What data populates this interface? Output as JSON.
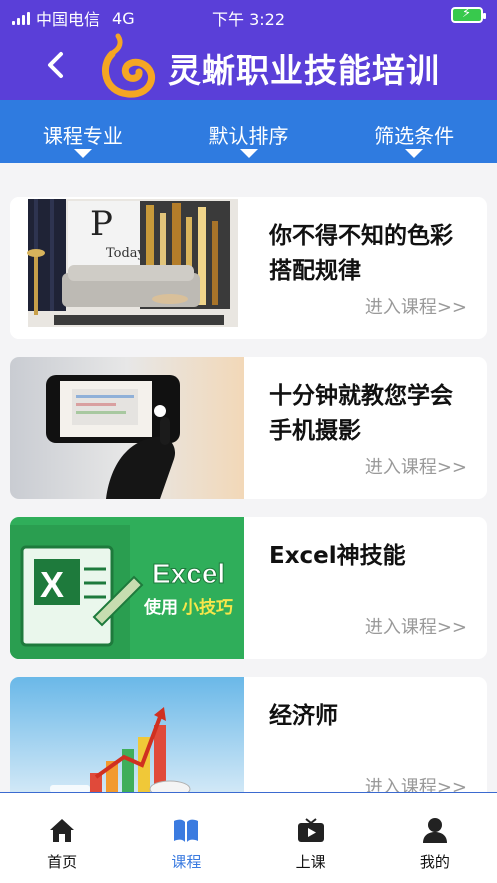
{
  "status_bar": {
    "carrier": "中国电信",
    "network": "4G",
    "time": "下午 3:22"
  },
  "header": {
    "title": "灵蜥职业技能培训",
    "back_icon": "chevron-left-icon",
    "logo_icon": "spiral-logo-icon"
  },
  "filters": [
    {
      "label": "课程专业"
    },
    {
      "label": "默认排序"
    },
    {
      "label": "筛选条件"
    }
  ],
  "courses": [
    {
      "title": "你不得不知的色彩搭配规律",
      "link": "进入课程>>",
      "thumb": "interior-design-thumbnail"
    },
    {
      "title": "十分钟就教您学会手机摄影",
      "link": "进入课程>>",
      "thumb": "phone-photography-thumbnail"
    },
    {
      "title": "Excel神技能",
      "link": "进入课程>>",
      "thumb": "excel-tips-thumbnail",
      "thumb_text": {
        "brand": "Excel",
        "prefix": "使用",
        "highlight": "小技巧"
      }
    },
    {
      "title": "经济师",
      "link": "进入课程>>",
      "thumb": "economist-chart-thumbnail"
    }
  ],
  "tabs": [
    {
      "label": "首页",
      "icon": "home-icon"
    },
    {
      "label": "课程",
      "icon": "book-icon",
      "active": true
    },
    {
      "label": "上课",
      "icon": "tv-icon"
    },
    {
      "label": "我的",
      "icon": "user-icon"
    }
  ],
  "colors": {
    "header_bg": "#5a3fd8",
    "filter_bg": "#2f7be0",
    "accent": "#3b7be0",
    "logo": "#f5a623"
  }
}
